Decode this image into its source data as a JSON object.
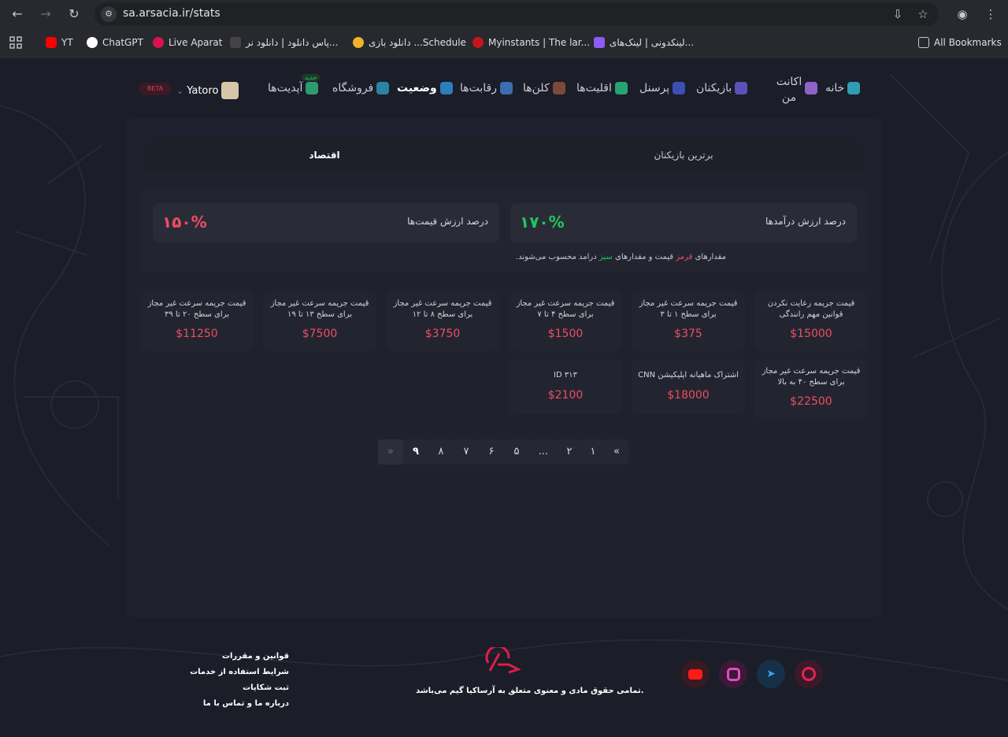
{
  "browser": {
    "url": "sa.arsacia.ir/stats",
    "bookmarks": [
      {
        "label": "YT"
      },
      {
        "label": "ChatGPT"
      },
      {
        "label": "Live Aparat"
      },
      {
        "label": "پاس دانلود | دانلود نر..."
      },
      {
        "label": "دانلود بازی ...Schedule"
      },
      {
        "label": "Myinstants | The lar..."
      },
      {
        "label": "لینکدونی | لینک‌های..."
      }
    ],
    "all_bookmarks": "All Bookmarks"
  },
  "nav": {
    "home": "خانه",
    "account": "اکانت من",
    "players": "بازیکنان",
    "personnel": "پرسنل",
    "minorities": "اقلیت‌ها",
    "clans": "کلن‌ها",
    "competitions": "رقابت‌ها",
    "status": "وضعیت",
    "shop": "فروشگاه",
    "updates": "آپدیت‌ها",
    "new_badge": "جدید",
    "user": "Yatoro",
    "beta": "BETA"
  },
  "tabs": {
    "top_players": "برترین بازیکنان",
    "economy": "اقتصاد"
  },
  "percent": {
    "income_label": "درصد ارزش درآمدها",
    "income_value": "۱۷۰%",
    "price_label": "درصد ارزش قیمت‌ها",
    "price_value": "۱۵۰%",
    "note_prefix": "مقدارهای",
    "note_red": "قرمز",
    "note_mid": "قیمت و مقدارهای",
    "note_green": "سبز",
    "note_suffix": "درامد محسوب می‌شوند."
  },
  "cards": [
    {
      "title": "قیمت جریمه رعایت نکردن قوانین مهم رانندگی",
      "value": "$15000"
    },
    {
      "title": "قیمت جریمه سرعت غیر مجاز برای سطح ۱ تا ۳",
      "value": "$375"
    },
    {
      "title": "قیمت جریمه سرعت غیر مجاز برای سطح ۴ تا ۷",
      "value": "$1500"
    },
    {
      "title": "قیمت جریمه سرعت غیر مجاز برای سطح ۸ تا ۱۲",
      "value": "$3750"
    },
    {
      "title": "قیمت جریمه سرعت غیر مجاز برای سطح ۱۳ تا ۱۹",
      "value": "$7500"
    },
    {
      "title": "قیمت جریمه سرعت غیر مجاز برای سطح ۲۰ تا ۳۹",
      "value": "$11250"
    },
    {
      "title": "قیمت جریمه سرعت غیر مجاز برای سطح ۴۰ به بالا",
      "value": "$22500"
    },
    {
      "title": "اشتراک ماهیانه اپلیکیشن CNN",
      "value": "$18000"
    },
    {
      "title": "ID ۳۱۳",
      "value": "$2100"
    }
  ],
  "pagination": [
    "«",
    "۱",
    "۲",
    "...",
    "۵",
    "۶",
    "۷",
    "۸",
    "۹",
    "»"
  ],
  "footer": {
    "links": [
      "قوانین و مقررات",
      "شرایط استفاده از خدمات",
      "ثبت شکایات",
      "درباره ما و تماس با ما"
    ],
    "copyright": "تمامی حقوق مادی و معنوی متعلق به آرساکیا گیم می‌باشد."
  },
  "colors": {
    "red": "#ef4d63",
    "green": "#22c55e",
    "accent": "#e11d48"
  }
}
